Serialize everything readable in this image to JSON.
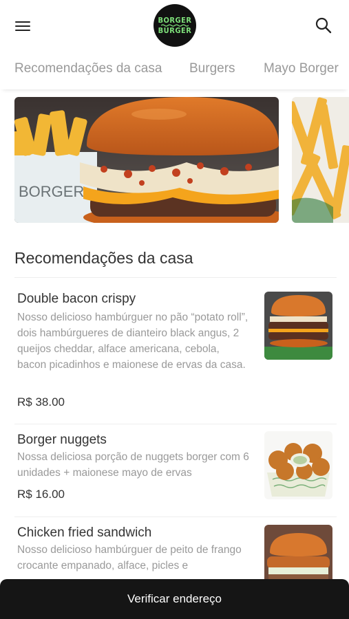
{
  "header": {
    "logo_text_top": "BORGER",
    "logo_text_bottom": "BURGER",
    "menu_icon": "hamburger-menu-icon",
    "search_icon": "search-icon"
  },
  "tabs": [
    {
      "label": "Recomendações da casa"
    },
    {
      "label": "Burgers"
    },
    {
      "label": "Mayo Borger"
    }
  ],
  "section": {
    "title": "Recomendações da casa"
  },
  "items": [
    {
      "name": "Double bacon crispy",
      "description": "Nosso delicioso hambúrguer no pão “potato roll”, dois hambúrgueres de dianteiro black angus, 2 queijos cheddar, alface americana, cebola, bacon picadinhos e maionese de ervas da casa.",
      "price": "R$ 38.00"
    },
    {
      "name": "Borger nuggets",
      "description": "Nossa deliciosa porção de nuggets borger com 6 unidades + maionese mayo de ervas",
      "price": "R$ 16.00"
    },
    {
      "name": "Chicken fried sandwich",
      "description": "Nosso delicioso hambúrguer de peito de frango crocante empanado, alface, picles e",
      "price": ""
    }
  ],
  "bottom_bar": {
    "label": "Verificar endereço"
  },
  "colors": {
    "accent": "#7ee07a",
    "dark": "#151515"
  }
}
